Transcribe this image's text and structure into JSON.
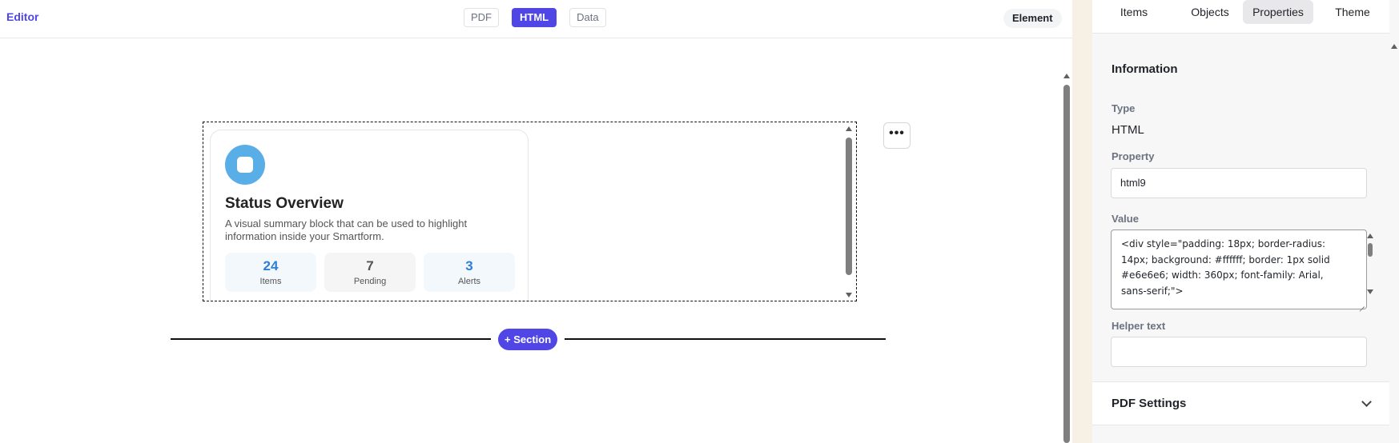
{
  "topbar": {
    "brand": "Editor",
    "modes": [
      "PDF",
      "HTML",
      "Data"
    ],
    "active_mode": "HTML",
    "element_label": "Element"
  },
  "canvas": {
    "card": {
      "title": "Status Overview",
      "description": "A visual summary block that can be used to highlight information inside your Smartform.",
      "stats": [
        {
          "value": "24",
          "label": "Items"
        },
        {
          "value": "7",
          "label": "Pending"
        },
        {
          "value": "3",
          "label": "Alerts"
        }
      ]
    },
    "more_button": "•••",
    "section_button": "+ Section"
  },
  "panel": {
    "tabs": [
      "Items",
      "Objects",
      "Properties",
      "Theme"
    ],
    "active_tab": "Properties",
    "section_title": "Information",
    "type_label": "Type",
    "type_value": "HTML",
    "property_label": "Property",
    "property_value": "html9",
    "value_label": "Value",
    "value_text": "<div style=\"padding: 18px; border-radius: 14px; background: #ffffff; border: 1px solid #e6e6e6; width: 360px; font-family: Arial, sans-serif;\">",
    "helper_label": "Helper text",
    "helper_value": "",
    "pdf_settings": "PDF Settings"
  },
  "colors": {
    "accent": "#4f46e5",
    "stat_blue": "#2b7fd4",
    "icon_blue": "#5aaee8",
    "divider_strip": "#f6f1e4"
  }
}
